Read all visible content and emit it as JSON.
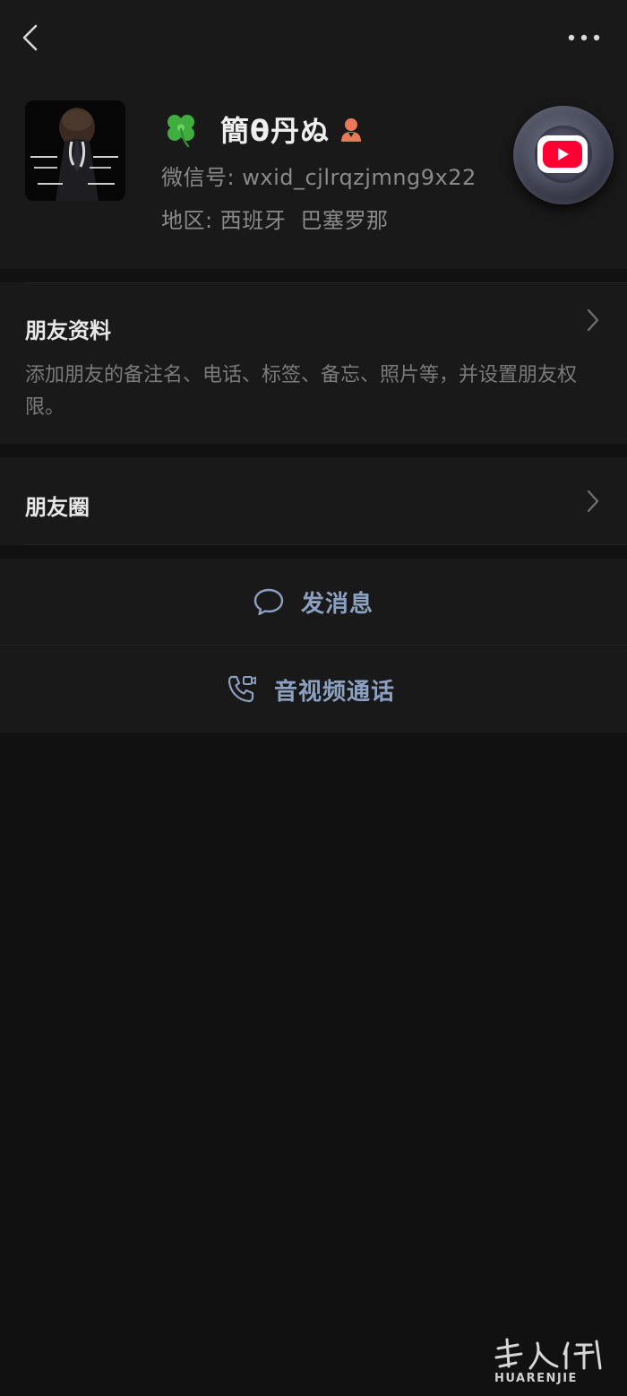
{
  "header": {
    "back_icon": "chevron-left-icon",
    "more_icon": "more-dots-icon"
  },
  "profile": {
    "avatar": "profile-photo",
    "clover": "🍀",
    "nickname": "簡θ丹ぬ",
    "gender_icon": "female-user-icon",
    "wxid_label": "微信号:",
    "wxid_value": "wxid_cjlrqzjmng9x22",
    "region_label": "地区:",
    "region_value": "西班牙  巴塞罗那",
    "floating_icon": "youtube-icon",
    "colors": {
      "youtube_red": "#ff0033",
      "accent_link": "#8ca0bf",
      "background": "#111111",
      "panel": "#191919"
    }
  },
  "friend_profile": {
    "title": "朋友资料",
    "description": "添加朋友的备注名、电话、标签、备忘、照片等，并设置朋友权限。"
  },
  "moments": {
    "title": "朋友圈"
  },
  "actions": {
    "send_message": "发消息",
    "av_call": "音视频通话"
  },
  "watermark": {
    "text": "HUARENJIE"
  }
}
